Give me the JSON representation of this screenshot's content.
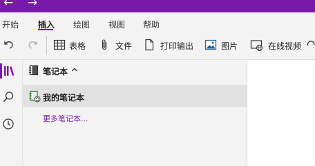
{
  "theme": {
    "accent": "#7719aa",
    "link": "#7719aa"
  },
  "titlebar": {
    "back_icon": "arrow-left-icon",
    "forward_icon": "arrow-right-icon"
  },
  "menu": {
    "tabs": [
      {
        "label": "开始",
        "active": false
      },
      {
        "label": "插入",
        "active": true
      },
      {
        "label": "绘图",
        "active": false
      },
      {
        "label": "视图",
        "active": false
      },
      {
        "label": "帮助",
        "active": false
      }
    ]
  },
  "ribbon": {
    "undo_icon": "undo-icon",
    "redo_icon": "redo-icon",
    "buttons": [
      {
        "label": "表格",
        "icon": "table-icon"
      },
      {
        "label": "文件",
        "icon": "paperclip-icon"
      },
      {
        "label": "打印输出",
        "icon": "document-icon"
      },
      {
        "label": "图片",
        "icon": "image-icon"
      },
      {
        "label": "在线视频",
        "icon": "video-icon"
      }
    ]
  },
  "left_rail": {
    "items": [
      {
        "icon": "notebooks-icon",
        "active": true
      },
      {
        "icon": "search-icon",
        "active": false
      },
      {
        "icon": "recent-icon",
        "active": false
      }
    ]
  },
  "notebook_panel": {
    "header_label": "笔记本",
    "header_icon": "notebook-icon",
    "caret_icon": "chevron-up-icon",
    "notebooks": [
      {
        "name": "我的笔记本",
        "icon": "notebook-sync-icon",
        "selected": true
      }
    ],
    "more_link": "更多笔记本..."
  }
}
